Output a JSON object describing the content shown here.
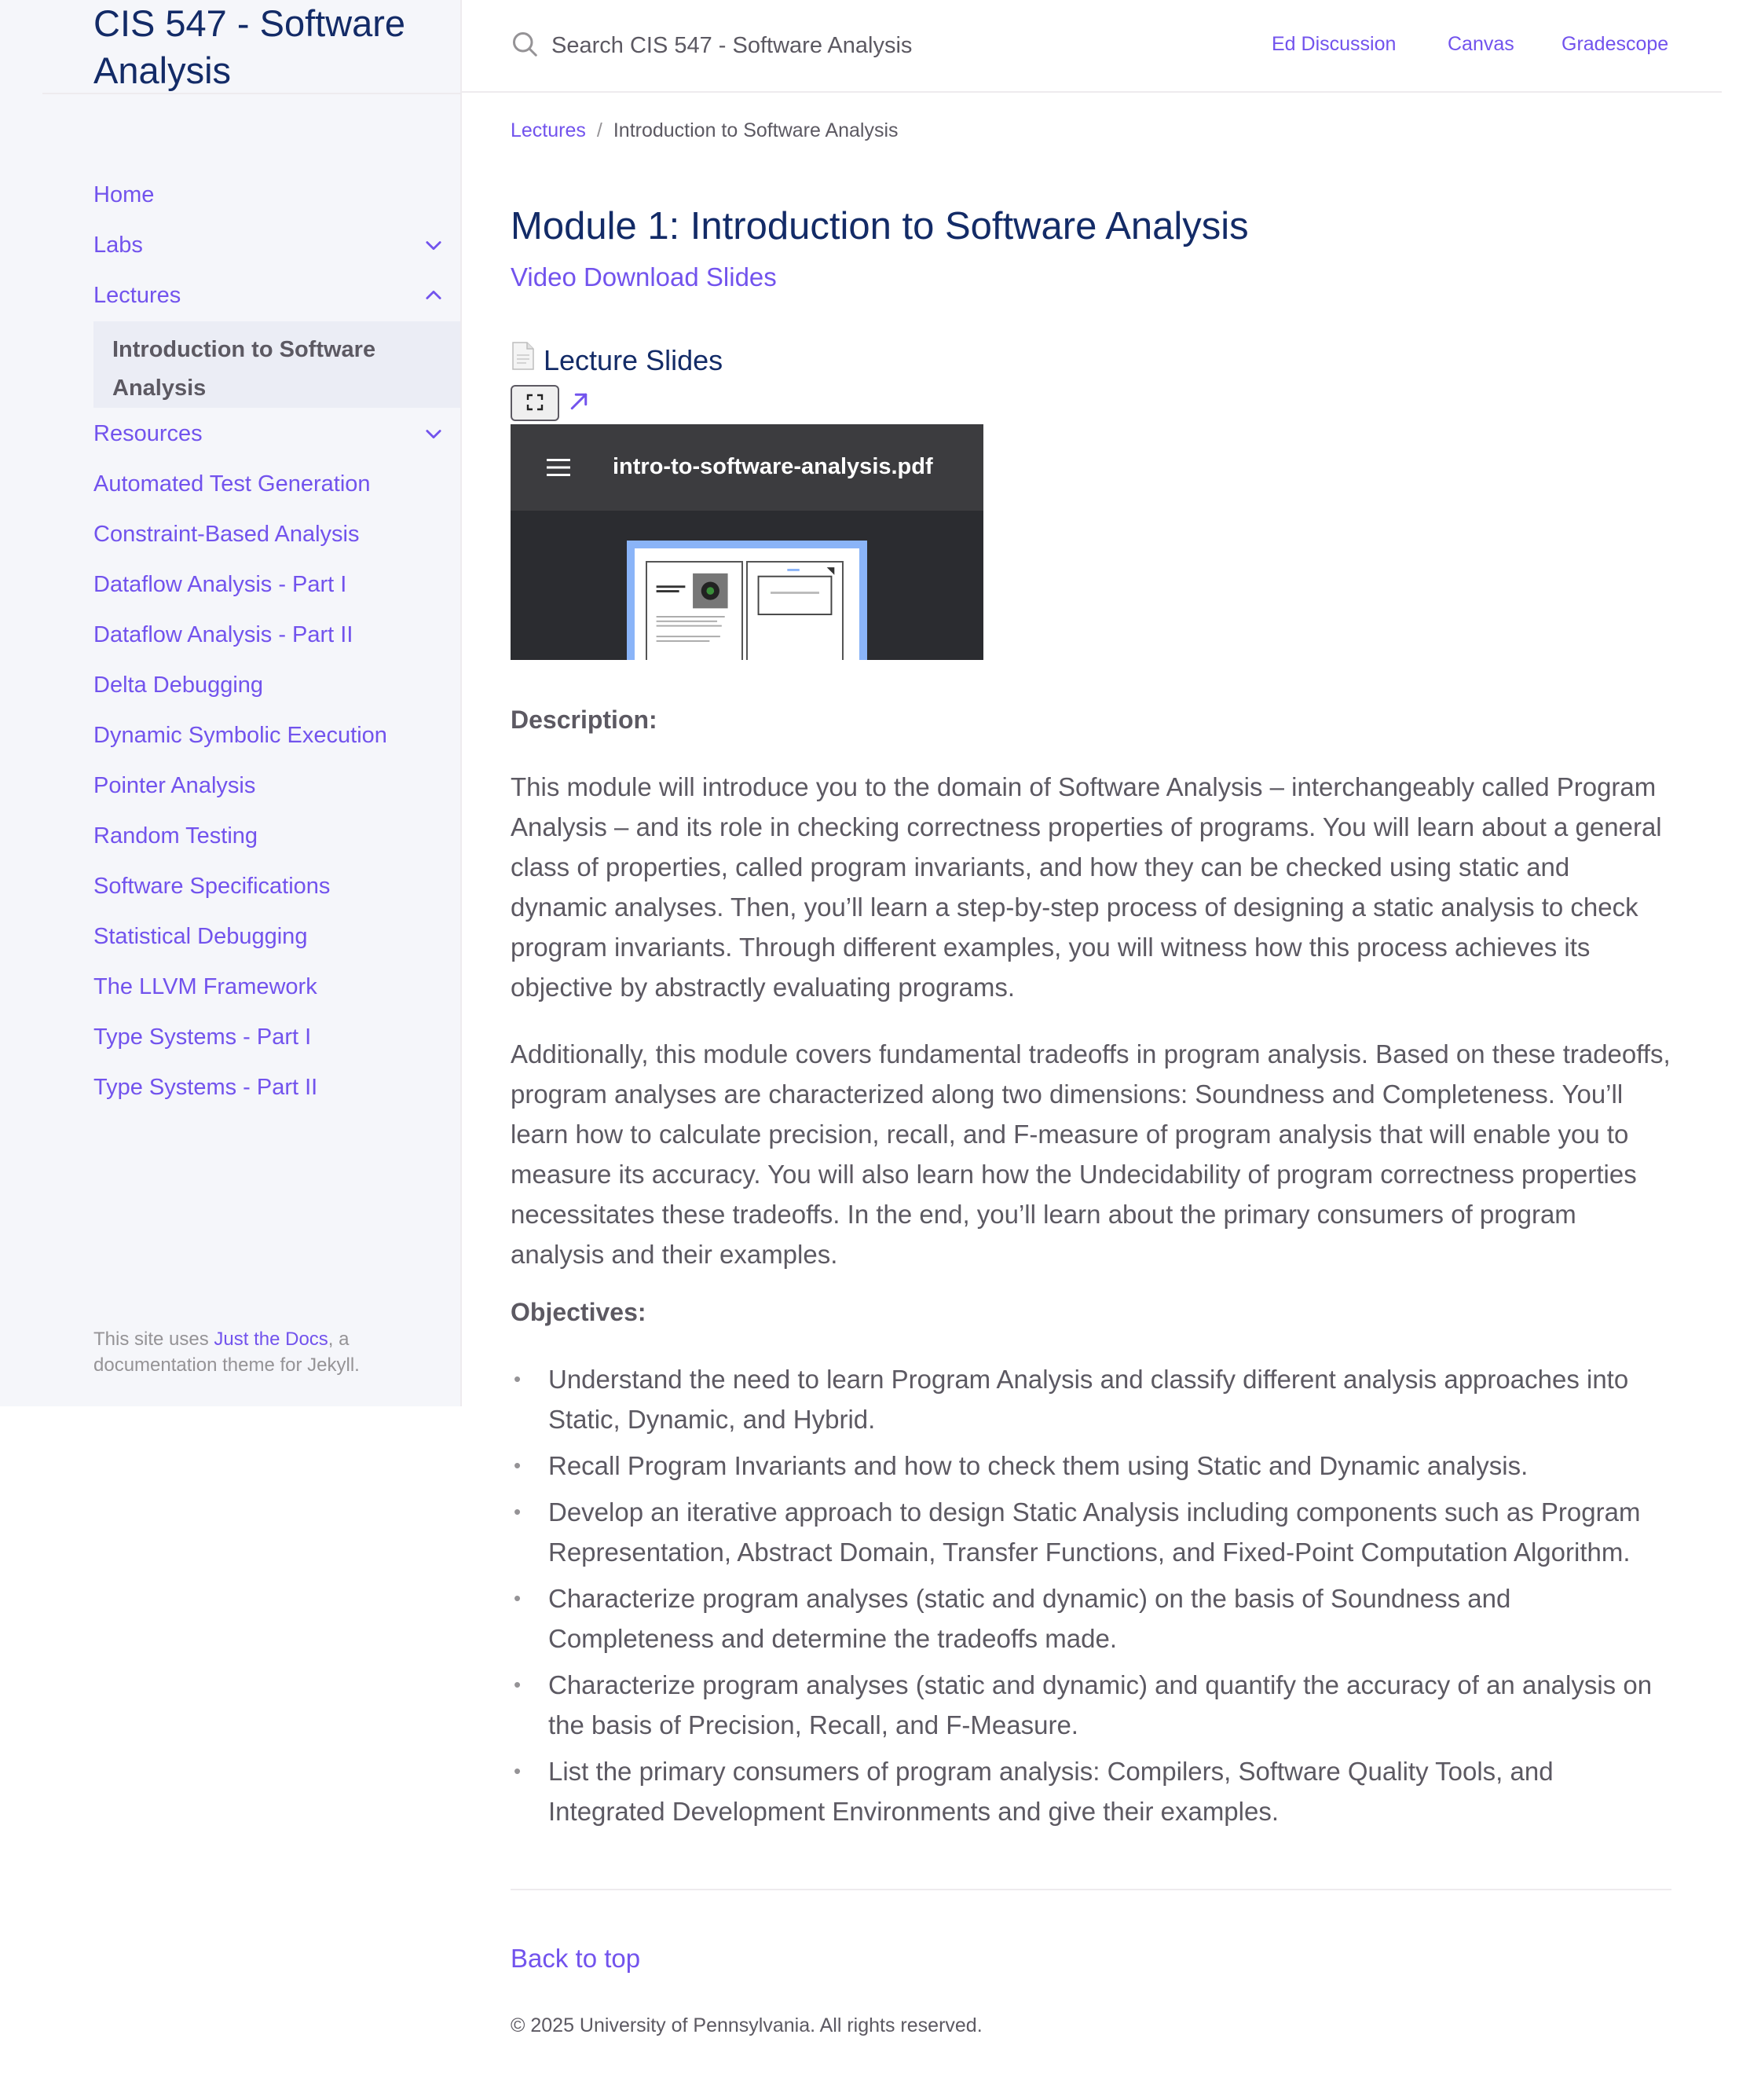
{
  "sidebar": {
    "site_title": "CIS 547 - Software Analysis",
    "items": [
      {
        "label": "Home"
      },
      {
        "label": "Labs"
      },
      {
        "label": "Lectures"
      },
      {
        "label": "Resources"
      },
      {
        "label": "Automated Test Generation"
      },
      {
        "label": "Constraint-Based Analysis"
      },
      {
        "label": "Dataflow Analysis - Part I"
      },
      {
        "label": "Dataflow Analysis - Part II"
      },
      {
        "label": "Delta Debugging"
      },
      {
        "label": "Dynamic Symbolic Execution"
      },
      {
        "label": "Pointer Analysis"
      },
      {
        "label": "Random Testing"
      },
      {
        "label": "Software Specifications"
      },
      {
        "label": "Statistical Debugging"
      },
      {
        "label": "The LLVM Framework"
      },
      {
        "label": "Type Systems - Part I"
      },
      {
        "label": "Type Systems - Part II"
      }
    ],
    "active_sub_item": "Introduction to Software Analysis",
    "footer": {
      "prefix": "This site uses ",
      "link": "Just the Docs",
      "suffix": ", a documentation theme for Jekyll."
    }
  },
  "header": {
    "search_placeholder": "Search CIS 547 - Software Analysis",
    "aux_links": [
      "Ed Discussion",
      "Canvas",
      "Gradescope"
    ]
  },
  "breadcrumb": {
    "parent": "Lectures",
    "separator": "/",
    "current": "Introduction to Software Analysis"
  },
  "page": {
    "title": "Module 1: Introduction to Software Analysis",
    "video_links": "Video Download Slides",
    "slides_heading": "Lecture Slides",
    "pdf_filename": "intro-to-software-analysis.pdf",
    "description_label": "Description:",
    "description_paragraphs": [
      "This module will introduce you to the domain of Software Analysis – interchangeably called Program Analysis – and its role in checking correctness properties of programs. You will learn about a general class of properties, called program invariants, and how they can be checked using static and dynamic analyses. Then, you’ll learn a step-by-step process of designing a static analysis to check program invariants. Through different examples, you will witness how this process achieves its objective by abstractly evaluating programs.",
      "Additionally, this module covers fundamental tradeoffs in program analysis. Based on these tradeoffs, program analyses are characterized along two dimensions: Soundness and Completeness. You’ll learn how to calculate precision, recall, and F-measure of program analysis that will enable you to measure its accuracy. You will also learn how the Undecidability of program correctness properties necessitates these tradeoffs. In the end, you’ll learn about the primary consumers of program analysis and their examples."
    ],
    "objectives_label": "Objectives:",
    "objectives": [
      "Understand the need to learn Program Analysis and classify different analysis approaches into Static, Dynamic, and Hybrid.",
      "Recall Program Invariants and how to check them using Static and Dynamic analysis.",
      "Develop an iterative approach to design Static Analysis including components such as Program Representation, Abstract Domain, Transfer Functions, and Fixed-Point Computation Algorithm.",
      "Characterize program analyses (static and dynamic) on the basis of Soundness and Completeness and determine the tradeoffs made.",
      "Characterize program analyses (static and dynamic) and quantify the accuracy of an analysis on the basis of Precision, Recall, and F-Measure.",
      "List the primary consumers of program analysis: Compilers, Software Quality Tools, and Integrated Development Environments and give their examples."
    ]
  },
  "footer": {
    "back_to_top": "Back to top",
    "copyright": "© 2025 University of Pennsylvania. All rights reserved."
  },
  "colors": {
    "link": "#7253ed",
    "title": "#132b67",
    "text": "#5c5962",
    "sidebar_bg": "#f5f6fa"
  }
}
